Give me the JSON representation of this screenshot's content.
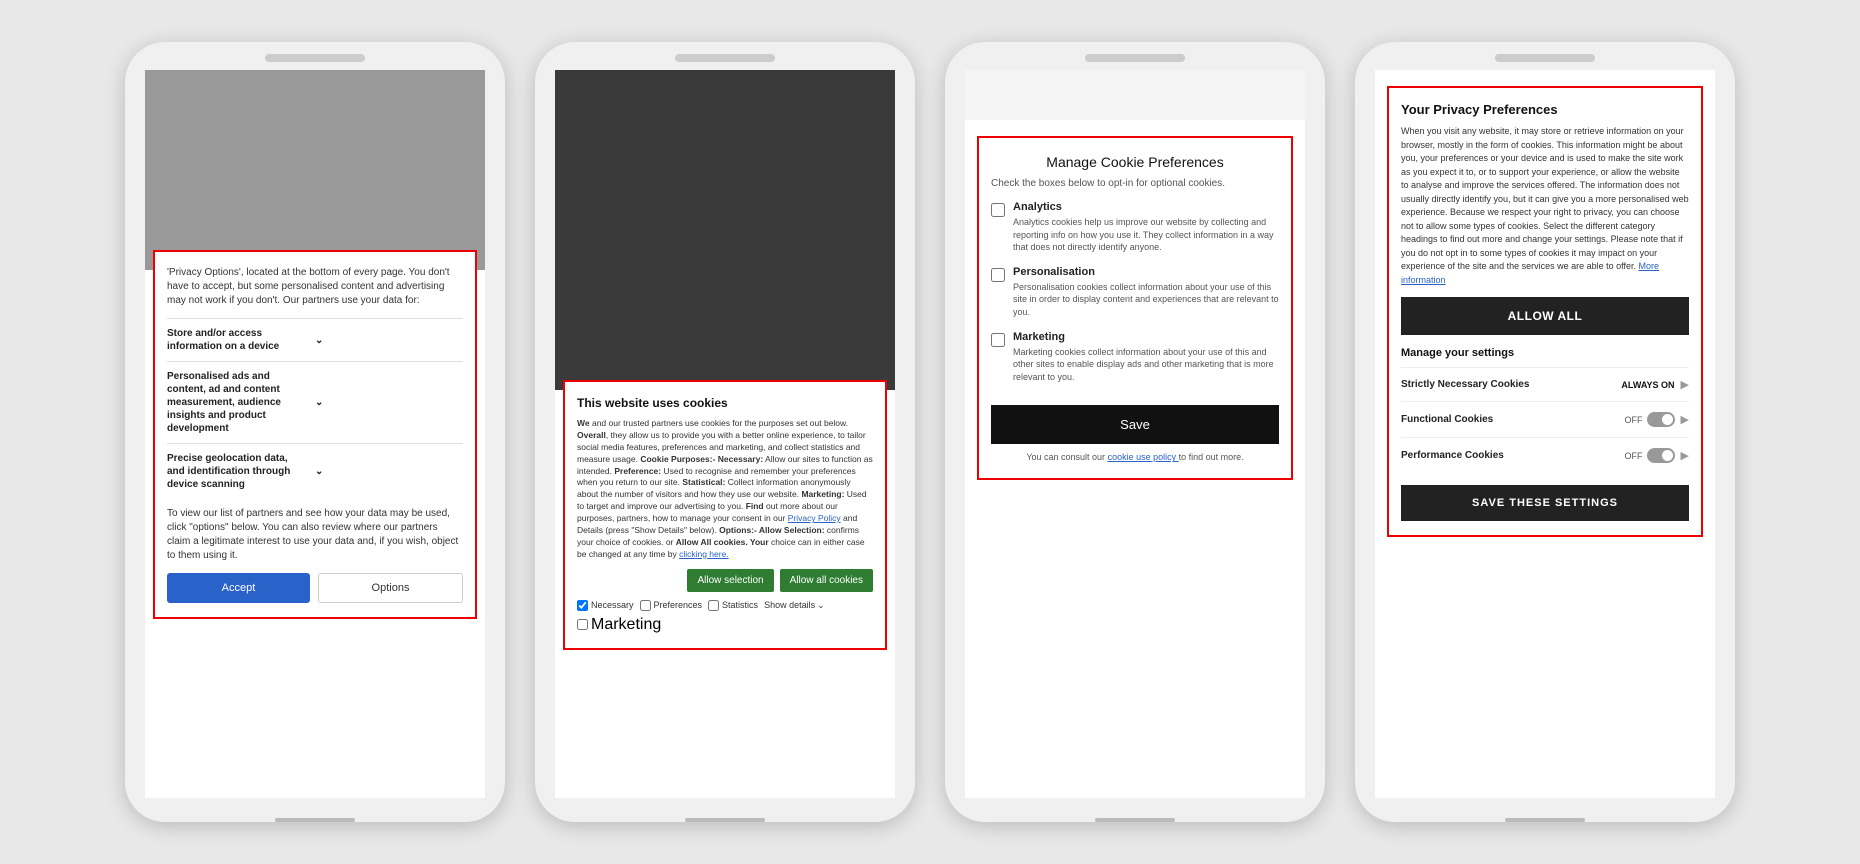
{
  "phone1": {
    "bg_color": "#999",
    "dialog": {
      "intro": "'Privacy Options', located at the bottom of every page. You don't have to accept, but some personalised content and advertising may not work if you don't. Our partners use your data for:",
      "items": [
        {
          "label": "Store and/or access information on a device"
        },
        {
          "label": "Personalised ads and content, ad and content measurement, audience insights and product development"
        },
        {
          "label": "Precise geolocation data, and identification through device scanning"
        }
      ],
      "footer_text": "To view our list of partners and see how your data may be used, click \"options\" below. You can also review where our partners claim a legitimate interest to use your data and, if you wish, object to them using it.",
      "accept_label": "Accept",
      "options_label": "Options"
    }
  },
  "phone2": {
    "dialog": {
      "title": "This website uses cookies",
      "body": "We and our trusted partners use cookies for the purposes set out below. Overall, they allow us to provide you with a better online experience, to tailor social media features, preferences and marketing, and collect statistics and measure usage. Cookie Purposes:- Necessary: Allow our sites to function as intended. Preference: Used to recognise and remember your preferences when you return to our site. Statistical: Collect information anonymously about the number of visitors and how they use our website. Marketing: Used to target and improve our advertising to you. Find out more about our purposes, partners, how to manage your consent in our Privacy Policy and Details (press \"Show Details\" below). Options:- Allow Selection: confirms your choice of cookies. or Allow All cookies. Your choice can in either case be changed at any time by clicking here.",
      "privacy_policy_link": "Privacy Policy",
      "clicking_here_link": "clicking here",
      "allow_selection_label": "Allow selection",
      "allow_all_label": "Allow all cookies",
      "checkboxes": [
        {
          "label": "Necessary",
          "checked": true
        },
        {
          "label": "Preferences",
          "checked": false
        },
        {
          "label": "Statistics",
          "checked": false
        },
        {
          "label": "Marketing",
          "checked": false
        }
      ],
      "show_details_label": "Show details"
    }
  },
  "phone3": {
    "dialog": {
      "title": "Manage Cookie Preferences",
      "subtitle": "Check the boxes below to opt-in for optional cookies.",
      "options": [
        {
          "label": "Analytics",
          "description": "Analytics cookies help us improve our website by collecting and reporting info on how you use it. They collect information in a way that does not directly identify anyone.",
          "checked": false
        },
        {
          "label": "Personalisation",
          "description": "Personalisation cookies collect information about your use of this site in order to display content and experiences that are relevant to you.",
          "checked": false
        },
        {
          "label": "Marketing",
          "description": "Marketing cookies collect information about your use of this and other sites to enable display ads and other marketing that is more relevant to you.",
          "checked": false
        }
      ],
      "save_label": "Save",
      "consult_text": "You can consult our",
      "cookie_policy_link": "cookie use policy",
      "consult_suffix": "to find out more."
    }
  },
  "phone4": {
    "dialog": {
      "title": "Your Privacy Preferences",
      "body_text": "When you visit any website, it may store or retrieve information on your browser, mostly in the form of cookies. This information might be about you, your preferences or your device and is used to make the site work as you expect it to, or to support your experience, or allow the website to analyse and improve the services offered. The information does not usually directly identify you, but it can give you a more personalised web experience. Because we respect your right to privacy, you can choose not to allow some types of cookies. Select the different category headings to find out more and change your settings. Please note that if you do not opt in to some types of cookies it may impact on your experience of the site and the services we are able to offer.",
      "more_info_link": "More information",
      "allow_all_label": "ALLOW ALL",
      "manage_settings_label": "Manage your settings",
      "rows": [
        {
          "label": "Strictly Necessary Cookies",
          "status": "ALWAYS ON",
          "type": "always_on"
        },
        {
          "label": "Functional Cookies",
          "status": "OFF",
          "type": "toggle"
        },
        {
          "label": "Performance Cookies",
          "status": "OFF",
          "type": "toggle"
        }
      ],
      "save_label": "SAVE THESE SETTINGS"
    }
  }
}
